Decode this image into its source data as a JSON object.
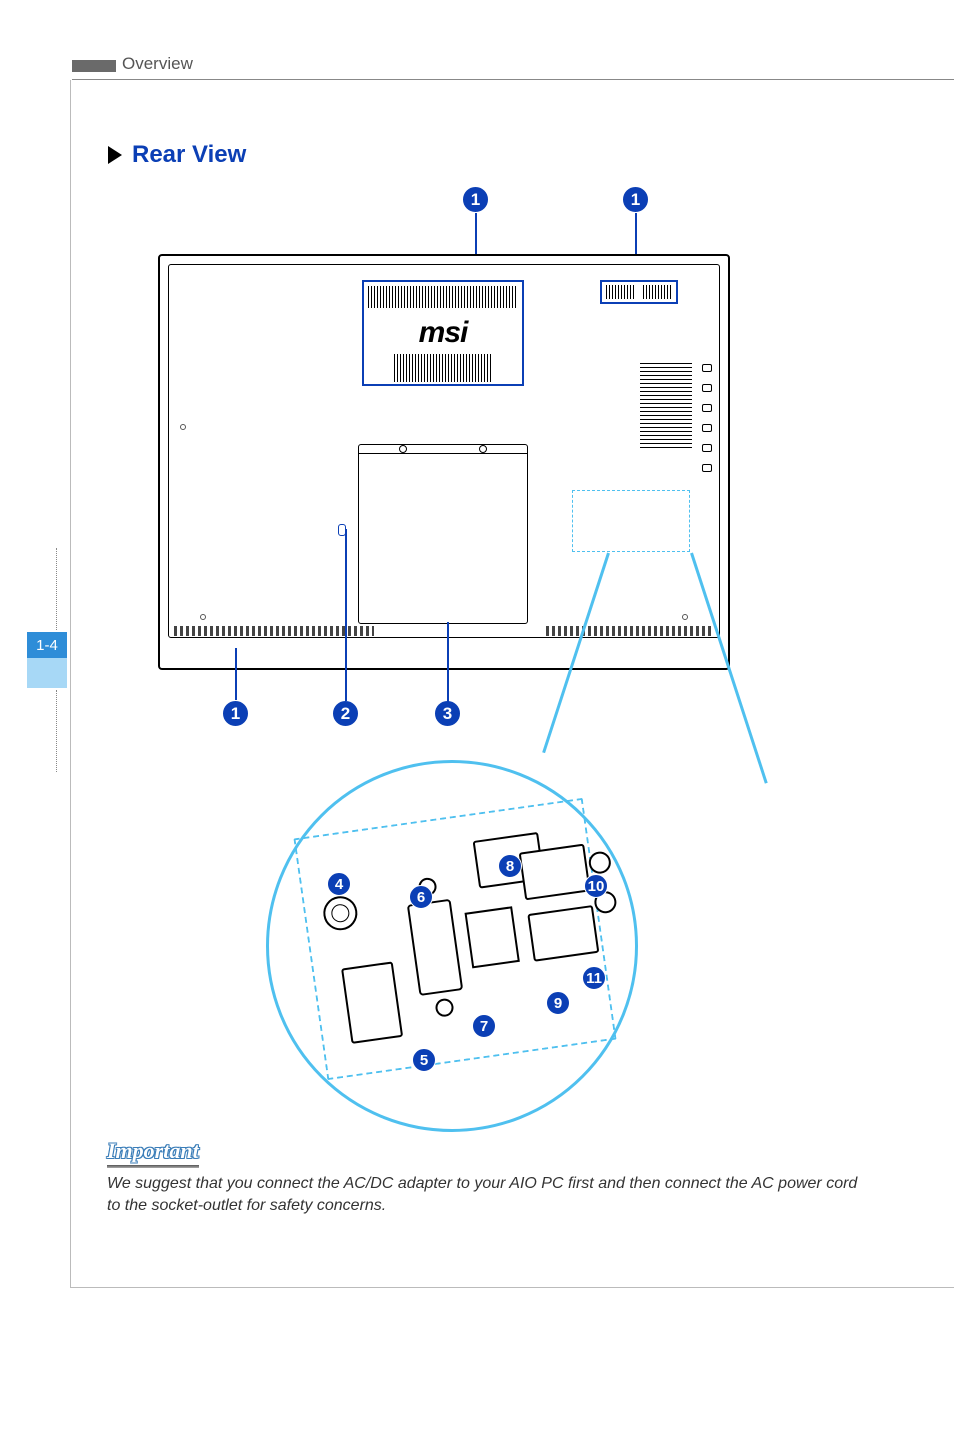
{
  "header": {
    "section": "Overview"
  },
  "page_number": "1-4",
  "section_title": "Rear View",
  "logo_text": "msi",
  "callouts": {
    "top_left": "1",
    "top_right": "1",
    "row_a": "1",
    "row_b": "2",
    "row_c": "3",
    "d4": "4",
    "d5": "5",
    "d6": "6",
    "d7": "7",
    "d8": "8",
    "d9": "9",
    "d10": "10",
    "d11": "11"
  },
  "important": {
    "label": "Important",
    "text": "We suggest that you connect the AC/DC adapter to your AIO PC first and then connect the AC power cord to the socket-outlet for safety concerns."
  }
}
